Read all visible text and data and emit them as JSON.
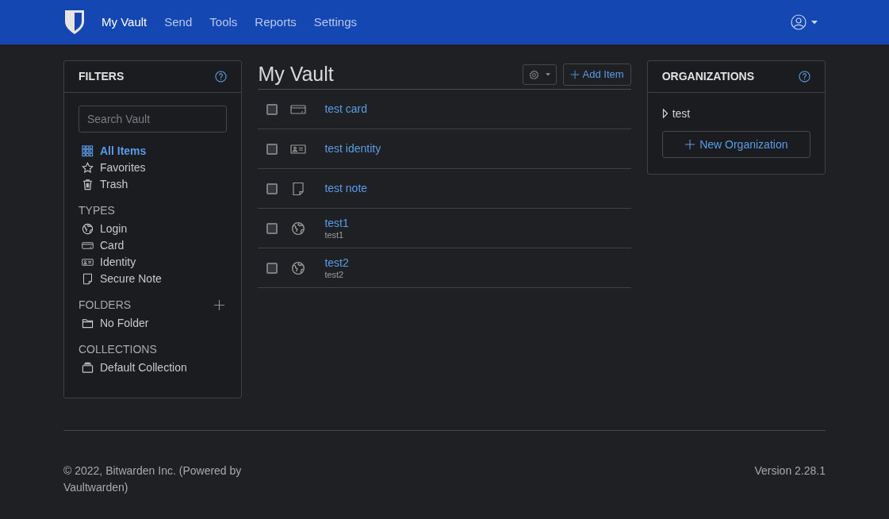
{
  "nav": {
    "items": [
      {
        "label": "My Vault",
        "selected": true
      },
      {
        "label": "Send",
        "selected": false
      },
      {
        "label": "Tools",
        "selected": false
      },
      {
        "label": "Reports",
        "selected": false
      },
      {
        "label": "Settings",
        "selected": false
      }
    ]
  },
  "filters": {
    "title": "FILTERS",
    "search": {
      "placeholder": "Search Vault"
    },
    "main": [
      {
        "label": "All Items",
        "kind": "all",
        "selected": true
      },
      {
        "label": "Favorites",
        "kind": "star",
        "selected": false
      },
      {
        "label": "Trash",
        "kind": "trash",
        "selected": false
      }
    ],
    "sections": [
      {
        "title": "TYPES",
        "add": false,
        "items": [
          {
            "label": "Login",
            "kind": "login",
            "selected": false
          },
          {
            "label": "Card",
            "kind": "card",
            "selected": false
          },
          {
            "label": "Identity",
            "kind": "identity",
            "selected": false
          },
          {
            "label": "Secure Note",
            "kind": "note",
            "selected": false
          }
        ]
      },
      {
        "title": "FOLDERS",
        "add": true,
        "items": [
          {
            "label": "No Folder",
            "kind": "folder",
            "selected": false
          }
        ]
      },
      {
        "title": "COLLECTIONS",
        "add": false,
        "items": [
          {
            "label": "Default Collection",
            "kind": "collection",
            "selected": false
          }
        ]
      }
    ]
  },
  "vault": {
    "title": "My Vault",
    "add_button": "Add Item",
    "rows": [
      {
        "kind": "card",
        "name": "test card",
        "checked": false
      },
      {
        "kind": "identity",
        "name": "test identity",
        "checked": false
      },
      {
        "kind": "note",
        "name": "test note",
        "checked": false
      },
      {
        "kind": "login",
        "name": "test1",
        "subtitle": "test1",
        "checked": false
      },
      {
        "kind": "login",
        "name": "test2",
        "subtitle": "test2",
        "checked": false
      }
    ]
  },
  "organizations": {
    "title": "ORGANIZATIONS",
    "items": [
      {
        "label": "test",
        "expanded": false
      }
    ],
    "new_button": "New Organization"
  },
  "footer": {
    "copyright": "© 2022, Bitwarden Inc. (Powered by Vaultwarden)",
    "version": "Version 2.28.1"
  }
}
